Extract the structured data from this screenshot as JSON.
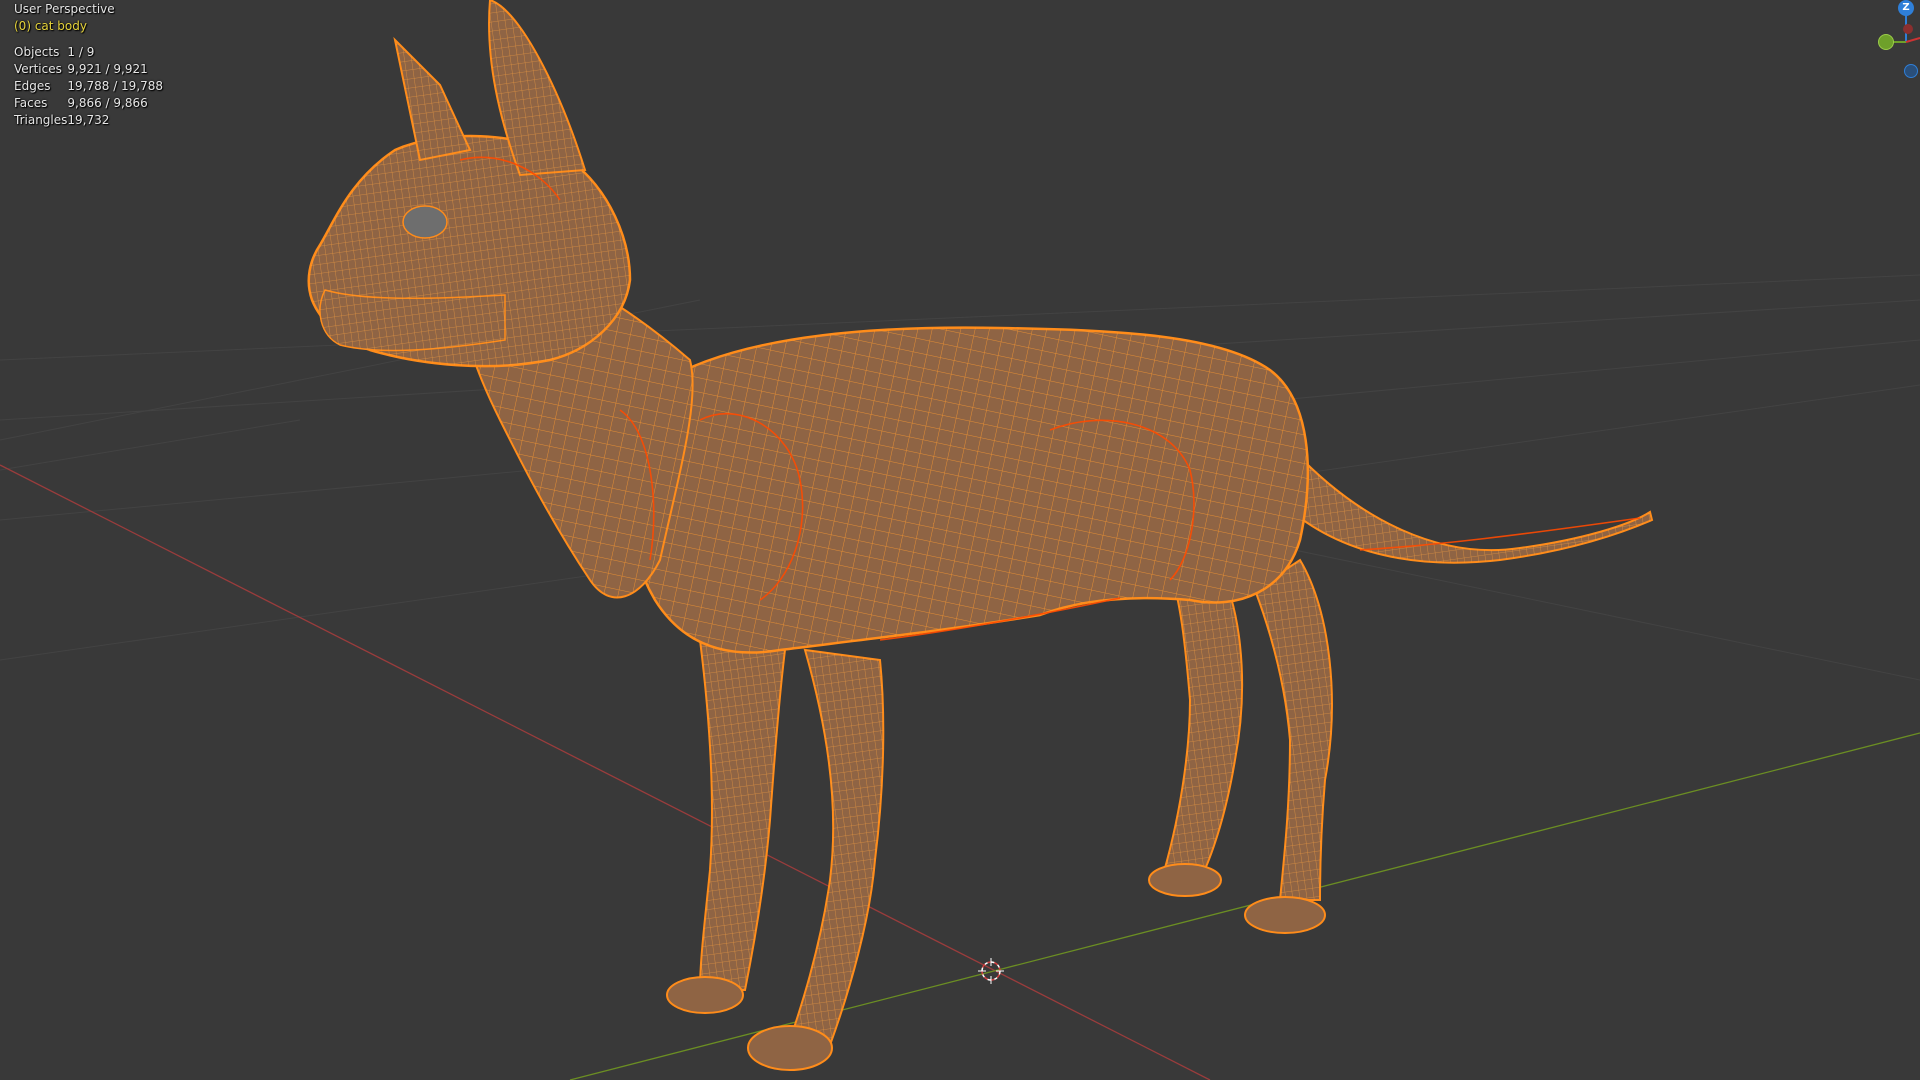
{
  "viewport": {
    "view_name": "User Perspective",
    "active_object": "(0) cat body",
    "stats": [
      {
        "key": "Objects",
        "value": "1 / 9"
      },
      {
        "key": "Vertices",
        "value": "9,921 / 9,921"
      },
      {
        "key": "Edges",
        "value": "19,788 / 19,788"
      },
      {
        "key": "Faces",
        "value": "9,866 / 9,866"
      },
      {
        "key": "Triangles",
        "value": "19,732"
      }
    ]
  },
  "gizmo": {
    "z_label": "Z"
  },
  "colors": {
    "background": "#393939",
    "grid": "#444444",
    "x_axis": "#9a3c3c",
    "y_axis": "#6b8e23",
    "wire_selected": "#ff8c1a",
    "wire_active_edge": "#ff4a00",
    "mesh_fill": "#8f6444",
    "active_text": "#e5d33a"
  },
  "icons": {
    "cursor": "3d-cursor-icon",
    "nav_gizmo": "navigation-gizmo-icon"
  }
}
